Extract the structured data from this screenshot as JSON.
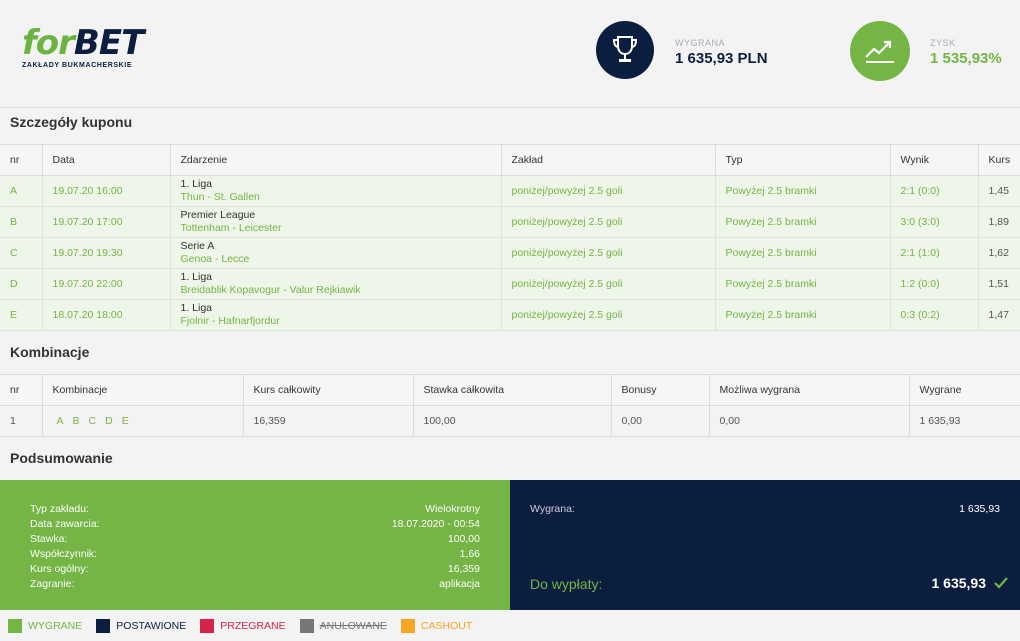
{
  "brand": {
    "name_f": "for",
    "name_bet": "BET",
    "subtitle": "ZAKŁADY BUKMACHERSKIE"
  },
  "stats": {
    "win": {
      "label": "WYGRANA",
      "value": "1 635,93 PLN",
      "icon": "trophy-icon"
    },
    "profit": {
      "label": "ZYSK",
      "value": "1 535,93%",
      "icon": "trend-up-icon"
    }
  },
  "coupon": {
    "title": "Szczegóły kuponu",
    "headers": [
      "nr",
      "Data",
      "Zdarzenie",
      "Zakład",
      "Typ",
      "Wynik",
      "Kurs"
    ],
    "rows": [
      {
        "nr": "A",
        "date": "19.07.20 16:00",
        "league": "1. Liga",
        "teams": "Thun - St. Gallen",
        "bet": "poniżej/powyżej 2.5 goli",
        "type": "Powyżej 2.5 bramki",
        "result": "2:1 (0:0)",
        "odds": "1,45"
      },
      {
        "nr": "B",
        "date": "19.07.20 17:00",
        "league": "Premier League",
        "teams": "Tottenham - Leicester",
        "bet": "poniżej/powyżej 2.5 goli",
        "type": "Powyżej 2.5 bramki",
        "result": "3:0 (3:0)",
        "odds": "1,89"
      },
      {
        "nr": "C",
        "date": "19.07.20 19:30",
        "league": "Serie A",
        "teams": "Genoa - Lecce",
        "bet": "poniżej/powyżej 2.5 goli",
        "type": "Powyżej 2.5 bramki",
        "result": "2:1 (1:0)",
        "odds": "1,62"
      },
      {
        "nr": "D",
        "date": "19.07.20 22:00",
        "league": "1. Liga",
        "teams": "Breidablik Kopavogur - Valur Rejkiawik",
        "bet": "poniżej/powyżej 2.5 goli",
        "type": "Powyżej 2.5 bramki",
        "result": "1:2 (0:0)",
        "odds": "1,51"
      },
      {
        "nr": "E",
        "date": "18.07.20 18:00",
        "league": "1. Liga",
        "teams": "Fjolnir - Hafnarfjordur",
        "bet": "poniżej/powyżej 2.5 goli",
        "type": "Powyżej 2.5 bramki",
        "result": "0:3 (0:2)",
        "odds": "1,47"
      }
    ]
  },
  "combinations": {
    "title": "Kombinacje",
    "headers": [
      "nr",
      "Kombinacje",
      "Kurs całkowity",
      "Stawka całkowita",
      "Bonusy",
      "Możliwa wygrana",
      "Wygrane"
    ],
    "rows": [
      {
        "nr": "1",
        "letters": [
          "A",
          "B",
          "C",
          "D",
          "E"
        ],
        "total_odds": "16,359",
        "total_stake": "100,00",
        "bonus": "0,00",
        "possible_win": "0,00",
        "won": "1 635,93"
      }
    ]
  },
  "summary": {
    "title": "Podsumowanie",
    "rows": [
      {
        "label": "Typ zakładu:",
        "value": "Wielokrotny"
      },
      {
        "label": "Data zawarcia:",
        "value": "18.07.2020 - 00:54"
      },
      {
        "label": "Stawka:",
        "value": "100,00"
      },
      {
        "label": "Współczynnik:",
        "value": "1,66"
      },
      {
        "label": "Kurs ogólny:",
        "value": "16,359"
      },
      {
        "label": "Zagranie:",
        "value": "aplikacja"
      }
    ],
    "win_label": "Wygrana:",
    "win_value": "1 635,93",
    "payout_label": "Do wypłaty:",
    "payout_value": "1 635,93"
  },
  "legend": [
    {
      "label": "WYGRANE",
      "color": "#74b545"
    },
    {
      "label": "POSTAWIONE",
      "color": "#0b1e3f"
    },
    {
      "label": "PRZEGRANE",
      "color": "#d6234a"
    },
    {
      "label": "ANULOWANE",
      "color": "#777777"
    },
    {
      "label": "CASHOUT",
      "color": "#f5a623"
    }
  ]
}
